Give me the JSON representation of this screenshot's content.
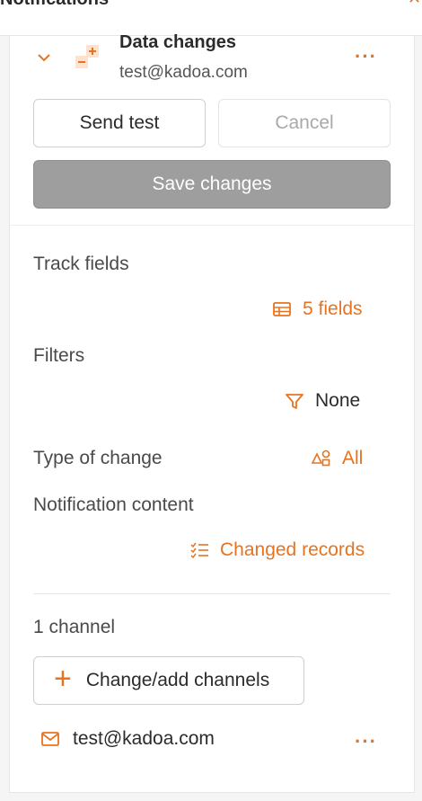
{
  "header": {
    "title": "Notifications",
    "close_icon": "close-icon"
  },
  "card": {
    "title": "Data changes",
    "subtitle": "test@kadoa.com",
    "icons": {
      "expand": "chevron-down-icon",
      "type": "diff-icon",
      "menu": "more-icon"
    },
    "buttons": {
      "send_test": "Send test",
      "cancel": "Cancel",
      "save": "Save changes"
    }
  },
  "settings": {
    "track_fields": {
      "label": "Track fields",
      "value": "5 fields",
      "icon": "table-icon"
    },
    "filters": {
      "label": "Filters",
      "value": "None",
      "icon": "filter-icon"
    },
    "type_of_change": {
      "label": "Type of change",
      "value": "All",
      "icon": "shapes-icon"
    },
    "notification_content": {
      "label": "Notification content",
      "value": "Changed records",
      "icon": "checklist-icon"
    }
  },
  "channels": {
    "count_label": "1 channel",
    "add_button": "Change/add channels",
    "items": [
      {
        "label": "test@kadoa.com",
        "icon": "mail-icon"
      }
    ]
  },
  "colors": {
    "accent": "#e8731f",
    "disabled": "#9e9e9e"
  }
}
